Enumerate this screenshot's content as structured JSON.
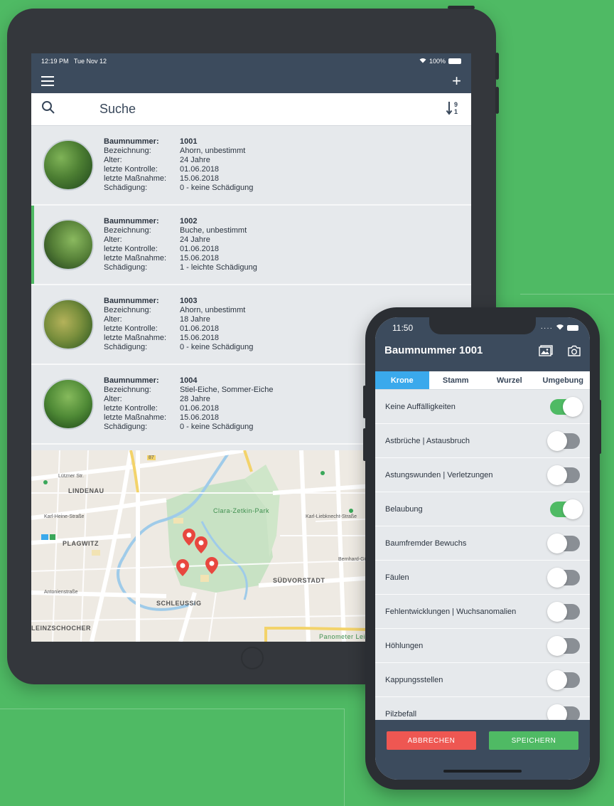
{
  "tablet": {
    "status": {
      "time": "12:19 PM",
      "date": "Tue Nov 12",
      "battery": "100%"
    },
    "nav": {
      "menu_icon": "hamburger-icon",
      "add_icon": "plus-icon"
    },
    "search": {
      "label": "Suche",
      "search_icon": "search-icon",
      "sort_icon": "sort-numeric-icon"
    },
    "labels": {
      "nummer": "Baumnummer:",
      "bezeichnung": "Bezeichnung:",
      "alter": "Alter:",
      "kontrolle": "letzte Kontrolle:",
      "massnahme": "letzte Maßnahme:",
      "schaedigung": "Schädigung:"
    },
    "trees": [
      {
        "nummer": "1001",
        "bezeichnung": "Ahorn, unbestimmt",
        "alter": "24 Jahre",
        "kontrolle": "01.06.2018",
        "massnahme": "15.06.2018",
        "schaedigung": "0 - keine Schädigung"
      },
      {
        "nummer": "1002",
        "bezeichnung": "Buche, unbestimmt",
        "alter": "24 Jahre",
        "kontrolle": "01.06.2018",
        "massnahme": "15.06.2018",
        "schaedigung": "1 - leichte Schädigung"
      },
      {
        "nummer": "1003",
        "bezeichnung": "Ahorn, unbestimmt",
        "alter": "18 Jahre",
        "kontrolle": "01.06.2018",
        "massnahme": "15.06.2018",
        "schaedigung": "0 - keine Schädigung"
      },
      {
        "nummer": "1004",
        "bezeichnung": "Stiel-Eiche, Sommer-Eiche",
        "alter": "28 Jahre",
        "kontrolle": "01.06.2018",
        "massnahme": "15.06.2018",
        "schaedigung": "0 - keine Schädigung"
      }
    ],
    "map": {
      "labels": {
        "lindenau": "LINDENAU",
        "plagwitz": "PLAGWITZ",
        "schleussig": "SCHLEUSSIG",
        "suedvorstadt": "SÜDVORSTADT",
        "kleinzschocher": "LEINZSCHOCHER",
        "park": "Clara-Zetkin-Park",
        "panometer": "Panometer Leip",
        "road87": "87",
        "luetzner": "Lützner Str.",
        "karlheine": "Karl-Heine-Straße",
        "antonien": "Antonienstraße",
        "bernhard": "Bernhard-Göring-Straße",
        "karlliebknecht": "Karl-Liebknecht-Straße"
      },
      "pin_color": "#e8473f"
    }
  },
  "phone": {
    "status": {
      "time": "11:50"
    },
    "title": "Baumnummer 1001",
    "icons": {
      "gallery": "gallery-icon",
      "camera": "camera-icon"
    },
    "tabs": [
      "Krone",
      "Stamm",
      "Wurzel",
      "Umgebung"
    ],
    "options": [
      {
        "label": "Keine Auffälligkeiten",
        "on": true
      },
      {
        "label": "Astbrüche | Astausbruch",
        "on": false
      },
      {
        "label": "Astungswunden | Verletzungen",
        "on": false
      },
      {
        "label": "Belaubung",
        "on": true
      },
      {
        "label": "Baumfremder Bewuchs",
        "on": false
      },
      {
        "label": "Fäulen",
        "on": false
      },
      {
        "label": "Fehlentwicklungen | Wuchsanomalien",
        "on": false
      },
      {
        "label": "Höhlungen",
        "on": false
      },
      {
        "label": "Kappungsstellen",
        "on": false
      },
      {
        "label": "Pilzbefall",
        "on": false
      }
    ],
    "buttons": {
      "cancel": "ABBRECHEN",
      "save": "SPEICHERN"
    }
  },
  "colors": {
    "background": "#4fba64",
    "header": "#3c4b5d",
    "tab_active": "#3aa9ec",
    "cancel": "#ee5752",
    "save": "#4fba64"
  }
}
